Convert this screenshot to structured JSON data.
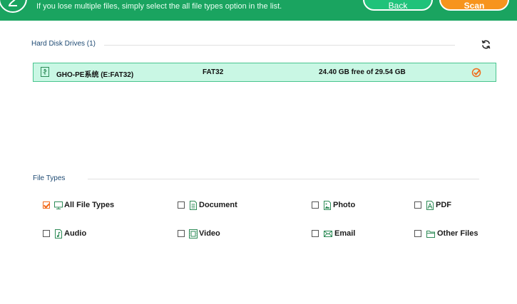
{
  "header": {
    "step_number": "2",
    "hint": "If you lose multiple files, simply select the all file types option in the list.",
    "back_label": "Back",
    "scan_label": "Scan",
    "bg_color": "#1aa460",
    "scan_color": "#f7941d"
  },
  "drives": {
    "title": "Hard Disk Drives (1)",
    "refresh_icon": "refresh-icon",
    "items": [
      {
        "name": "GHO-PE系统 (E:FAT32)",
        "fs": "FAT32",
        "space": "24.40 GB free of 29.54 GB",
        "selected": true,
        "icon": "usb-drive-icon"
      }
    ]
  },
  "file_types": {
    "title": "File Types",
    "items": [
      {
        "label": "All File Types",
        "checked": true,
        "icon": "monitor-icon"
      },
      {
        "label": "Document",
        "checked": false,
        "icon": "document-icon"
      },
      {
        "label": "Photo",
        "checked": false,
        "icon": "photo-icon"
      },
      {
        "label": "PDF",
        "checked": false,
        "icon": "pdf-icon"
      },
      {
        "label": "Audio",
        "checked": false,
        "icon": "audio-icon"
      },
      {
        "label": "Video",
        "checked": false,
        "icon": "video-icon"
      },
      {
        "label": "Email",
        "checked": false,
        "icon": "email-icon"
      },
      {
        "label": "Other Files",
        "checked": false,
        "icon": "folder-icon"
      }
    ]
  },
  "colors": {
    "accent_green": "#49c48e",
    "selected_row": "#c9f7e4",
    "check_orange": "#f26a1b",
    "section_title": "#1e4a73"
  }
}
